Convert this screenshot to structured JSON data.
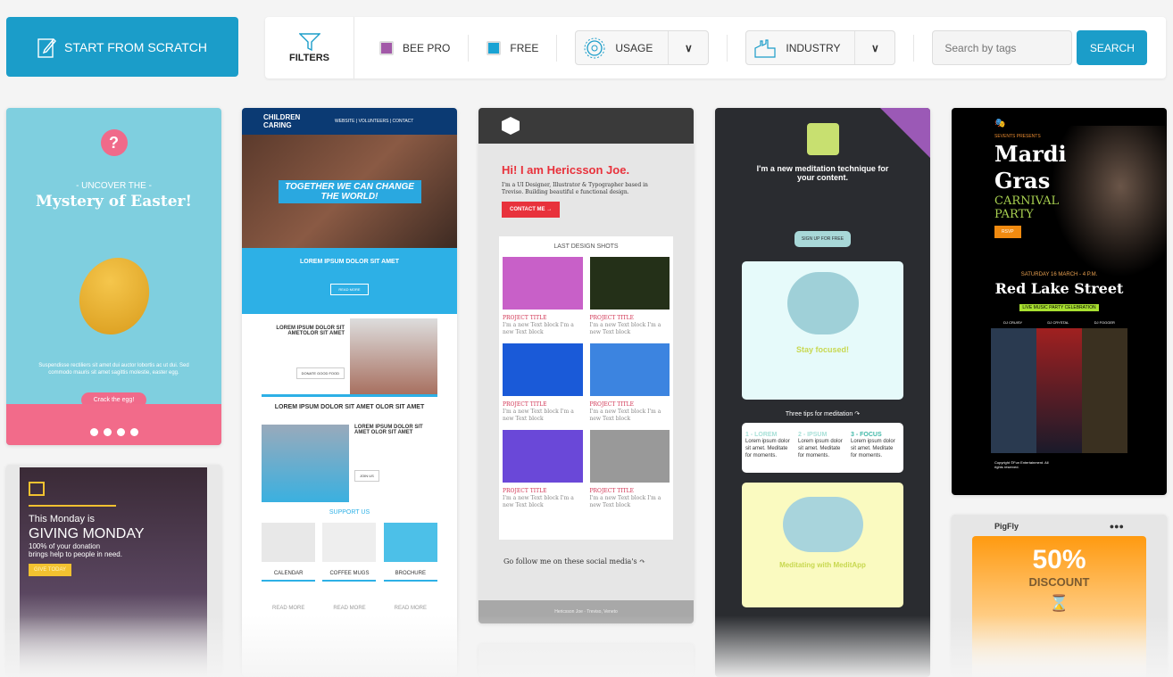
{
  "start_button": {
    "label": "START FROM SCRATCH",
    "icon": "edit-icon"
  },
  "toolbar": {
    "filters_label": "FILTERS",
    "bee_pro": {
      "label": "BEE PRO",
      "color": "#a259a8"
    },
    "free": {
      "label": "FREE",
      "color": "#1aa3d4"
    },
    "usage": {
      "label": "USAGE",
      "icon": "gear-icon"
    },
    "industry": {
      "label": "INDUSTRY",
      "icon": "factory-icon"
    },
    "search_placeholder": "Search by tags",
    "search_label": "SEARCH"
  },
  "templates": {
    "easter": {
      "kicker": "- UNCOVER THE -",
      "title": "Mystery of Easter!",
      "body": "Suspendisse rectiliers sit amet dui auctor lobortis ac ut dui. Sed commodo mauris sit amet sagittis molestie, easter egg.",
      "cta": "Crack the egg!"
    },
    "giving": {
      "line1": "This Monday is",
      "title": "GIVING MONDAY",
      "line2": "100% of your donation",
      "line3": "brings help to people in need.",
      "cta": "GIVE TODAY"
    },
    "children": {
      "brand": "CHILDREN CARING",
      "nav": "WEBSITE | VOLUNTEERS | CONTACT",
      "hero": "TOGETHER WE CAN CHANGE THE WORLD!",
      "h1": "LOREM IPSUM DOLOR SIT AMET",
      "b1": "READ MORE",
      "h2": "LOREM IPSUM DOLOR SIT AMETOLOR SIT AMET",
      "b2": "DONATE GOOD FOOD",
      "h3": "LOREM IPSUM DOLOR SIT AMET OLOR SIT AMET",
      "h4": "LOREM IPSUM DOLOR SIT AMET OLOR SIT AMET",
      "b4": "JOIN US",
      "support": "SUPPORT US",
      "products": [
        "CALENDAR",
        "COFFEE MUGS",
        "BROCHURE"
      ],
      "read_more": "READ MORE"
    },
    "hericsson": {
      "title": "Hi! I am Hericsson Joe.",
      "sub": "I'm a UI Designer, Illustrator & Typographer based in Treviso. Building beautiful e functional design.",
      "cta": "CONTACT ME →",
      "shots": "LAST DESIGN SHOTS",
      "project": "PROJECT TITLE",
      "project_text": "I'm a new Text block I'm a new Text block",
      "follow": "Go follow me on these social media's ↷",
      "footer": "Hericsson Joe · Treviso, Veneto"
    },
    "meditation": {
      "title": "I'm a new meditation technique for your content.",
      "cta": "SIGN UP FOR FREE",
      "focus": "Stay focused!",
      "tips": "Three tips for meditation ↷",
      "tip_titles": [
        "1 - LOREM",
        "2 - IPSUM",
        "3 - FOCUS"
      ],
      "tip_text": "Lorem ipsum dolor sit amet. Meditate for moments.",
      "app": "Meditating with MeditApp"
    },
    "mardi": {
      "presents": "SEVENTS PRESENTS",
      "title1": "Mardi",
      "title2": "Gras",
      "sub1": "CARNIVAL",
      "sub2": "PARTY",
      "cta": "RSVP",
      "date": "SATURDAY 16 MARCH - 4 P.M.",
      "street": "Red Lake Street",
      "tag": "LIVE MUSIC PARTY CELEBRATION",
      "djs": [
        "DJ CRUISY",
        "DJ CRYSTAL",
        "DJ FOGGER"
      ],
      "copyright": "Copyright ©Fun Entertainment. All rights reserved."
    },
    "pigfly": {
      "brand": "PigFly",
      "pct": "50%",
      "discount": "DISCOUNT"
    }
  }
}
